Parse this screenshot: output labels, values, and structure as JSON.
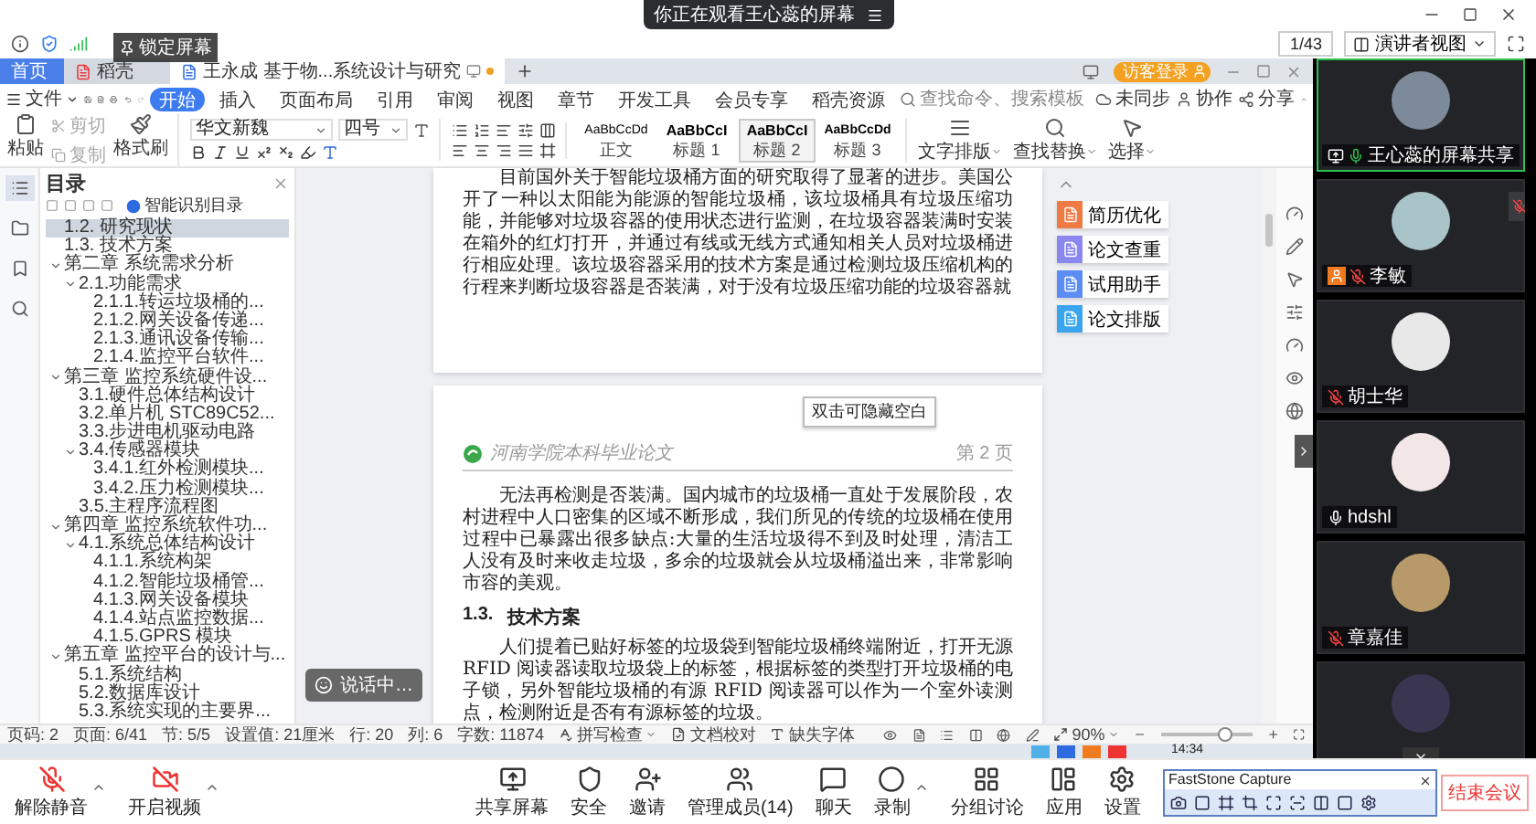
{
  "banner": {
    "text": "你正在观看王心蕊的屏幕"
  },
  "viewer_bar": {
    "page": "1/43",
    "view_mode": "演讲者视图"
  },
  "lock_screen": {
    "label": "锁定屏幕"
  },
  "wps": {
    "tabs": [
      {
        "label": "首页",
        "kind": "home",
        "selected": true,
        "unsaved": false
      },
      {
        "label": "稻壳",
        "kind": "docer",
        "selected": false,
        "unsaved": false
      },
      {
        "label": "王永成 基于物...系统设计与研究",
        "kind": "doc",
        "selected": false,
        "unsaved": true
      }
    ],
    "login": "访客登录",
    "file_menu": "文件",
    "menu": [
      {
        "label": "开始",
        "selected": true
      },
      {
        "label": "插入",
        "selected": false
      },
      {
        "label": "页面布局",
        "selected": false
      },
      {
        "label": "引用",
        "selected": false
      },
      {
        "label": "审阅",
        "selected": false
      },
      {
        "label": "视图",
        "selected": false
      },
      {
        "label": "章节",
        "selected": false
      },
      {
        "label": "开发工具",
        "selected": false
      },
      {
        "label": "会员专享",
        "selected": false
      },
      {
        "label": "稻壳资源",
        "selected": false
      }
    ],
    "search": {
      "placeholder": "查找命令、搜索模板"
    },
    "actions": [
      {
        "label": "未同步",
        "kind": "sync"
      },
      {
        "label": "协作",
        "kind": "collab"
      },
      {
        "label": "分享",
        "kind": "share"
      }
    ],
    "ribbon": {
      "paste": "粘贴",
      "cut": "剪切",
      "copy": "复制",
      "format_painter": "格式刷",
      "font": "华文新魏",
      "size": "四号",
      "styles": [
        {
          "sample": "AaBbCcDd",
          "name": "正文",
          "selected": false
        },
        {
          "sample": "AaBbCcI",
          "name": "标题 1",
          "selected": false
        },
        {
          "sample": "AaBbCcI",
          "name": "标题 2",
          "selected": true
        },
        {
          "sample": "AaBbCcDd",
          "name": "标题 3",
          "selected": false
        }
      ],
      "tools": [
        {
          "label": "文字排版",
          "kind": "layout"
        },
        {
          "label": "查找替换",
          "kind": "find"
        },
        {
          "label": "选择",
          "kind": "select"
        }
      ]
    }
  },
  "toc": {
    "title": "目录",
    "smart": "智能识别目录",
    "items": [
      {
        "label": "1.2. 研究现状",
        "selected": true
      },
      {
        "label": "1.3. 技术方案",
        "selected": false
      },
      {
        "label": "第二章 系统需求分析",
        "selected": false,
        "expanded": true,
        "children": [
          {
            "label": "2.1.功能需求",
            "selected": false,
            "expanded": true,
            "children": [
              {
                "label": "2.1.1.转运垃圾桶的...",
                "selected": false
              },
              {
                "label": "2.1.2.网关设备传递...",
                "selected": false
              },
              {
                "label": "2.1.3.通讯设备传输...",
                "selected": false
              },
              {
                "label": "2.1.4.监控平台软件...",
                "selected": false
              }
            ]
          }
        ]
      },
      {
        "label": "第三章 监控系统硬件设...",
        "selected": false,
        "expanded": true,
        "children": [
          {
            "label": "3.1.硬件总体结构设计",
            "selected": false
          },
          {
            "label": "3.2.单片机 STC89C52...",
            "selected": false
          },
          {
            "label": "3.3.步进电机驱动电路",
            "selected": false
          },
          {
            "label": "3.4.传感器模块",
            "selected": false,
            "expanded": true,
            "children": [
              {
                "label": "3.4.1.红外检测模块...",
                "selected": false
              },
              {
                "label": "3.4.2.压力检测模块...",
                "selected": false
              }
            ]
          },
          {
            "label": "3.5.主程序流程图",
            "selected": false
          }
        ]
      },
      {
        "label": "第四章 监控系统软件功...",
        "selected": false,
        "expanded": true,
        "children": [
          {
            "label": "4.1.系统总体结构设计",
            "selected": false,
            "expanded": true,
            "children": [
              {
                "label": "4.1.1.系统构架",
                "selected": false
              },
              {
                "label": "4.1.2.智能垃圾桶管...",
                "selected": false
              },
              {
                "label": "4.1.3.网关设备模块",
                "selected": false
              },
              {
                "label": "4.1.4.站点监控数据...",
                "selected": false
              },
              {
                "label": "4.1.5.GPRS 模块",
                "selected": false
              }
            ]
          }
        ]
      },
      {
        "label": "第五章 监控平台的设计与...",
        "selected": false,
        "expanded": true,
        "children": [
          {
            "label": "5.1.系统结构",
            "selected": false
          },
          {
            "label": "5.2.数据库设计",
            "selected": false
          },
          {
            "label": "5.3.系统实现的主要界...",
            "selected": false
          }
        ]
      }
    ]
  },
  "document": {
    "page_one": {
      "blocks": [
        {
          "kind": "paragraph",
          "text": "目前国外关于智能垃圾桶方面的研究取得了显著的进步。美国公开了一种以太阳能为能源的智能垃圾桶，该垃圾桶具有垃圾压缩功能，并能够对垃圾容器的使用状态进行监测，在垃圾容器装满时安装在箱外的红灯打开，并通过有线或无线方式通知相关人员对垃圾桶进行相应处理。该垃圾容器采用的技术方案是通过检测垃圾压缩机构的行程来判断垃圾容器是否装满，对于没有垃圾压缩功能的垃圾容器就"
        }
      ]
    },
    "gap_tip": "双击可隐藏空白",
    "page_two": {
      "header_title": "河南学院本科毕业论文",
      "header_page": "第 2 页",
      "blocks": [
        {
          "kind": "paragraph",
          "text": "无法再检测是否装满。国内城市的垃圾桶一直处于发展阶段，农村进程中人口密集的区域不断形成，我们所见的传统的垃圾桶在使用过程中已暴露出很多缺点:大量的生活垃圾得不到及时处理，清洁工人没有及时来收走垃圾，多余的垃圾就会从垃圾桶溢出来，非常影响市容的美观。"
        },
        {
          "kind": "heading",
          "number": "1.3.",
          "text": "技术方案"
        },
        {
          "kind": "paragraph",
          "text": "人们提着已贴好标签的垃圾袋到智能垃圾桶终端附近，打开无源 RFID 阅读器读取垃圾袋上的标签，根据标签的类型打开垃圾桶的电子锁，另外智能垃圾桶的有源 RFID 阅读器可以作为一个室外读测点，检测附近是否有有源标签的垃圾。"
        }
      ]
    }
  },
  "side_panel": [
    {
      "label": "简历优化",
      "color": "#f07a43"
    },
    {
      "label": "论文查重",
      "color": "#8a87f0"
    },
    {
      "label": "试用助手",
      "color": "#5b8df5"
    },
    {
      "label": "论文排版",
      "color": "#3aa5ee"
    }
  ],
  "status_bar": {
    "items": [
      {
        "label": "页码: 2",
        "kind": "text"
      },
      {
        "label": "页面: 6/41",
        "kind": "text"
      },
      {
        "label": "节: 5/5",
        "kind": "text"
      },
      {
        "label": "设置值: 21厘米",
        "kind": "text"
      },
      {
        "label": "行: 20",
        "kind": "text"
      },
      {
        "label": "列: 6",
        "kind": "text"
      },
      {
        "label": "字数: 11874",
        "kind": "text"
      },
      {
        "label": "拼写检查",
        "kind": "spell"
      },
      {
        "label": "文档校对",
        "kind": "proof"
      },
      {
        "label": "缺失字体",
        "kind": "font"
      }
    ],
    "zoom": "90%",
    "zoom_slider": {
      "level": 0.7
    }
  },
  "taskbar": {
    "clock": "14:34"
  },
  "speaking": {
    "label": "说话中…"
  },
  "participants": [
    {
      "name": "王心蕊的屏幕共享",
      "muted": false,
      "speaking": true,
      "sharing": true,
      "host": false
    },
    {
      "name": "李敏",
      "muted": true,
      "speaking": false,
      "sharing": false,
      "host": true
    },
    {
      "name": "胡士华",
      "muted": true,
      "speaking": false,
      "sharing": false,
      "host": false
    },
    {
      "name": "hdshl",
      "muted": false,
      "speaking": false,
      "sharing": false,
      "host": false
    },
    {
      "name": "章嘉佳",
      "muted": true,
      "speaking": false,
      "sharing": false,
      "host": false
    }
  ],
  "toolbar": {
    "left": [
      {
        "label": "解除静音",
        "kind": "mic",
        "off": true,
        "has_menu": true
      },
      {
        "label": "开启视频",
        "kind": "video",
        "off": true,
        "has_menu": true
      }
    ],
    "center": [
      {
        "label": "共享屏幕",
        "kind": "share",
        "has_menu": false
      },
      {
        "label": "安全",
        "kind": "security",
        "has_menu": false
      },
      {
        "label": "邀请",
        "kind": "invite",
        "has_menu": false
      },
      {
        "label": "管理成员(14)",
        "kind": "members",
        "has_menu": false
      },
      {
        "label": "聊天",
        "kind": "chat",
        "has_menu": false
      },
      {
        "label": "录制",
        "kind": "record",
        "has_menu": true
      },
      {
        "label": "分组讨论",
        "kind": "breakout",
        "has_menu": false
      },
      {
        "label": "应用",
        "kind": "apps",
        "has_menu": false
      },
      {
        "label": "设置",
        "kind": "settings",
        "has_menu": false
      }
    ],
    "end": "结束会议"
  },
  "faststone": {
    "title": "FastStone Capture"
  }
}
